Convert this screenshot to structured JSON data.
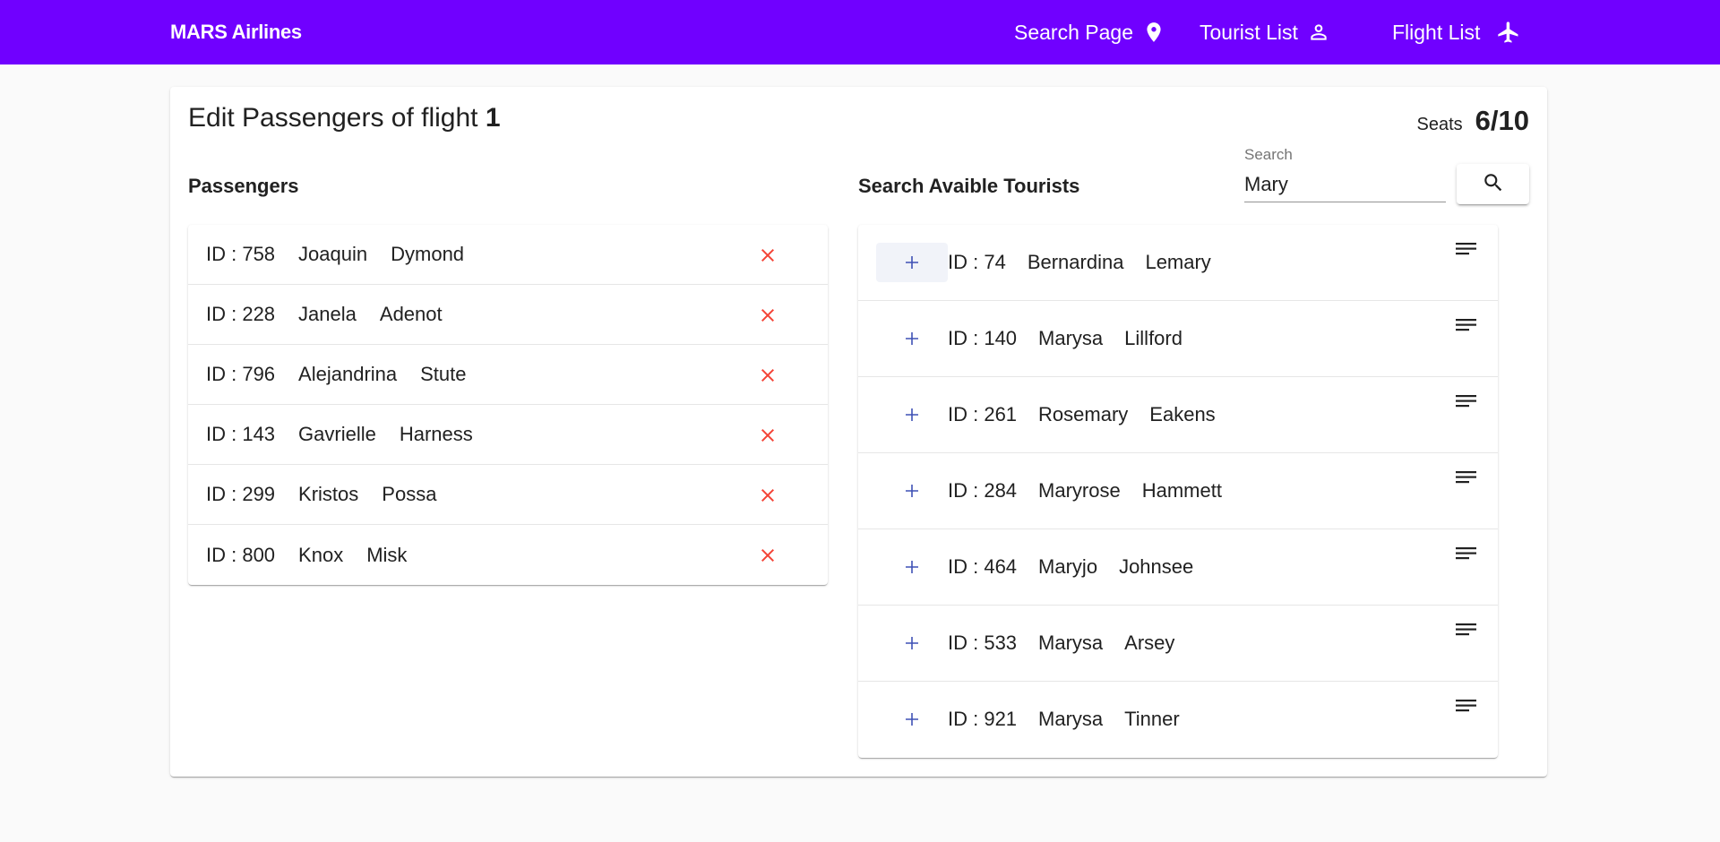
{
  "toolbar": {
    "brand": "MARS Airlines",
    "nav": [
      {
        "label": "Search Page",
        "icon": "location-pin-icon"
      },
      {
        "label": "Tourist List",
        "icon": "person-icon"
      },
      {
        "label": "Flight List",
        "icon": "airplane-icon"
      }
    ],
    "color": "#7000ff"
  },
  "page": {
    "title_prefix": "Edit Passengers of flight",
    "flight_number": "1",
    "seats_label": "Seats",
    "seats_value": "6/10"
  },
  "passengers": {
    "title": "Passengers",
    "remove_icon": "close-icon",
    "remove_color": "#f44336",
    "items": [
      {
        "id": "ID : 758",
        "first": "Joaquin",
        "last": "Dymond"
      },
      {
        "id": "ID : 228",
        "first": "Janela",
        "last": "Adenot"
      },
      {
        "id": "ID : 796",
        "first": "Alejandrina",
        "last": "Stute"
      },
      {
        "id": "ID : 143",
        "first": "Gavrielle",
        "last": "Harness"
      },
      {
        "id": "ID : 299",
        "first": "Kristos",
        "last": "Possa"
      },
      {
        "id": "ID : 800",
        "first": "Knox",
        "last": "Misk"
      }
    ]
  },
  "tourists": {
    "title": "Search Avaible Tourists",
    "search_label": "Search",
    "search_value": "Mary",
    "search_icon": "search-icon",
    "add_icon": "plus-icon",
    "menu_icon": "notes-icon",
    "accent": "#3f51b5",
    "items": [
      {
        "id": "ID : 74",
        "first": "Bernardina",
        "last": "Lemary"
      },
      {
        "id": "ID : 140",
        "first": "Marysa",
        "last": "Lillford"
      },
      {
        "id": "ID : 261",
        "first": "Rosemary",
        "last": "Eakens"
      },
      {
        "id": "ID : 284",
        "first": "Maryrose",
        "last": "Hammett"
      },
      {
        "id": "ID : 464",
        "first": "Maryjo",
        "last": "Johnsee"
      },
      {
        "id": "ID : 533",
        "first": "Marysa",
        "last": "Arsey"
      },
      {
        "id": "ID : 921",
        "first": "Marysa",
        "last": "Tinner"
      }
    ]
  }
}
